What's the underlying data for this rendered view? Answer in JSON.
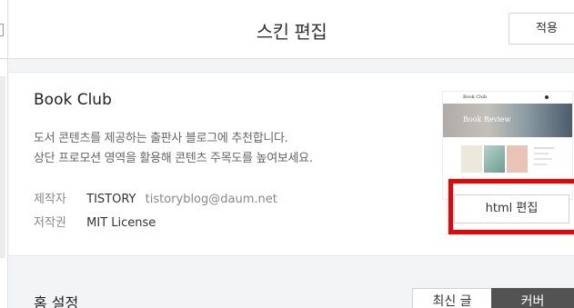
{
  "header": {
    "title": "스킨 편집",
    "apply_label": "적용"
  },
  "skin": {
    "name": "Book Club",
    "description": [
      "도서 콘텐츠를 제공하는 출판사 블로그에 추천합니다.",
      "상단 프로모션 영역을 활용해 콘텐츠 주목도를 높여보세요."
    ],
    "author_label": "제작자",
    "author": "TISTORY",
    "author_email": "tistoryblog@daum.net",
    "license_label": "저작권",
    "license": "MIT License",
    "thumbnail": {
      "brand": "Book Club",
      "hero_text": "Book Review"
    },
    "html_edit_label": "html 편집"
  },
  "home": {
    "title": "홈 설정",
    "tabs": [
      "최신 글",
      "커버"
    ],
    "active_tab": "커버"
  },
  "colors": {
    "highlight": "#f20000",
    "active_tab_bg": "#535353"
  }
}
